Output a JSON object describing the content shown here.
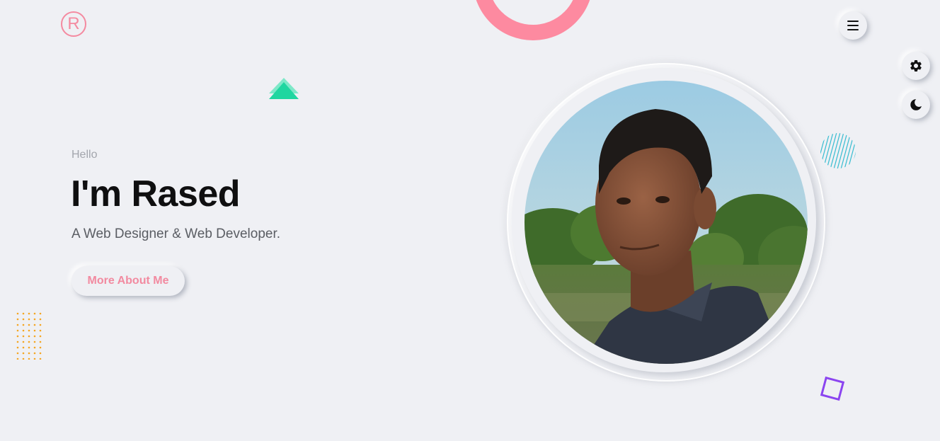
{
  "header": {
    "logo_letter": "R",
    "menu_icon": "hamburger-menu-icon"
  },
  "side_controls": {
    "settings_icon": "gear-icon",
    "theme_icon": "moon-icon"
  },
  "hero": {
    "greeting": "Hello",
    "title": "I'm Rased",
    "subtitle": "A Web Designer & Web Developer.",
    "cta_label": "More About Me"
  },
  "colors": {
    "accent_pink": "#f48aa0",
    "triangle_green": "#1fd6a0",
    "dots_orange": "#f5a623",
    "stripes_teal": "#37bcd0",
    "square_purple": "#8b44f0",
    "background": "#eff0f4"
  }
}
